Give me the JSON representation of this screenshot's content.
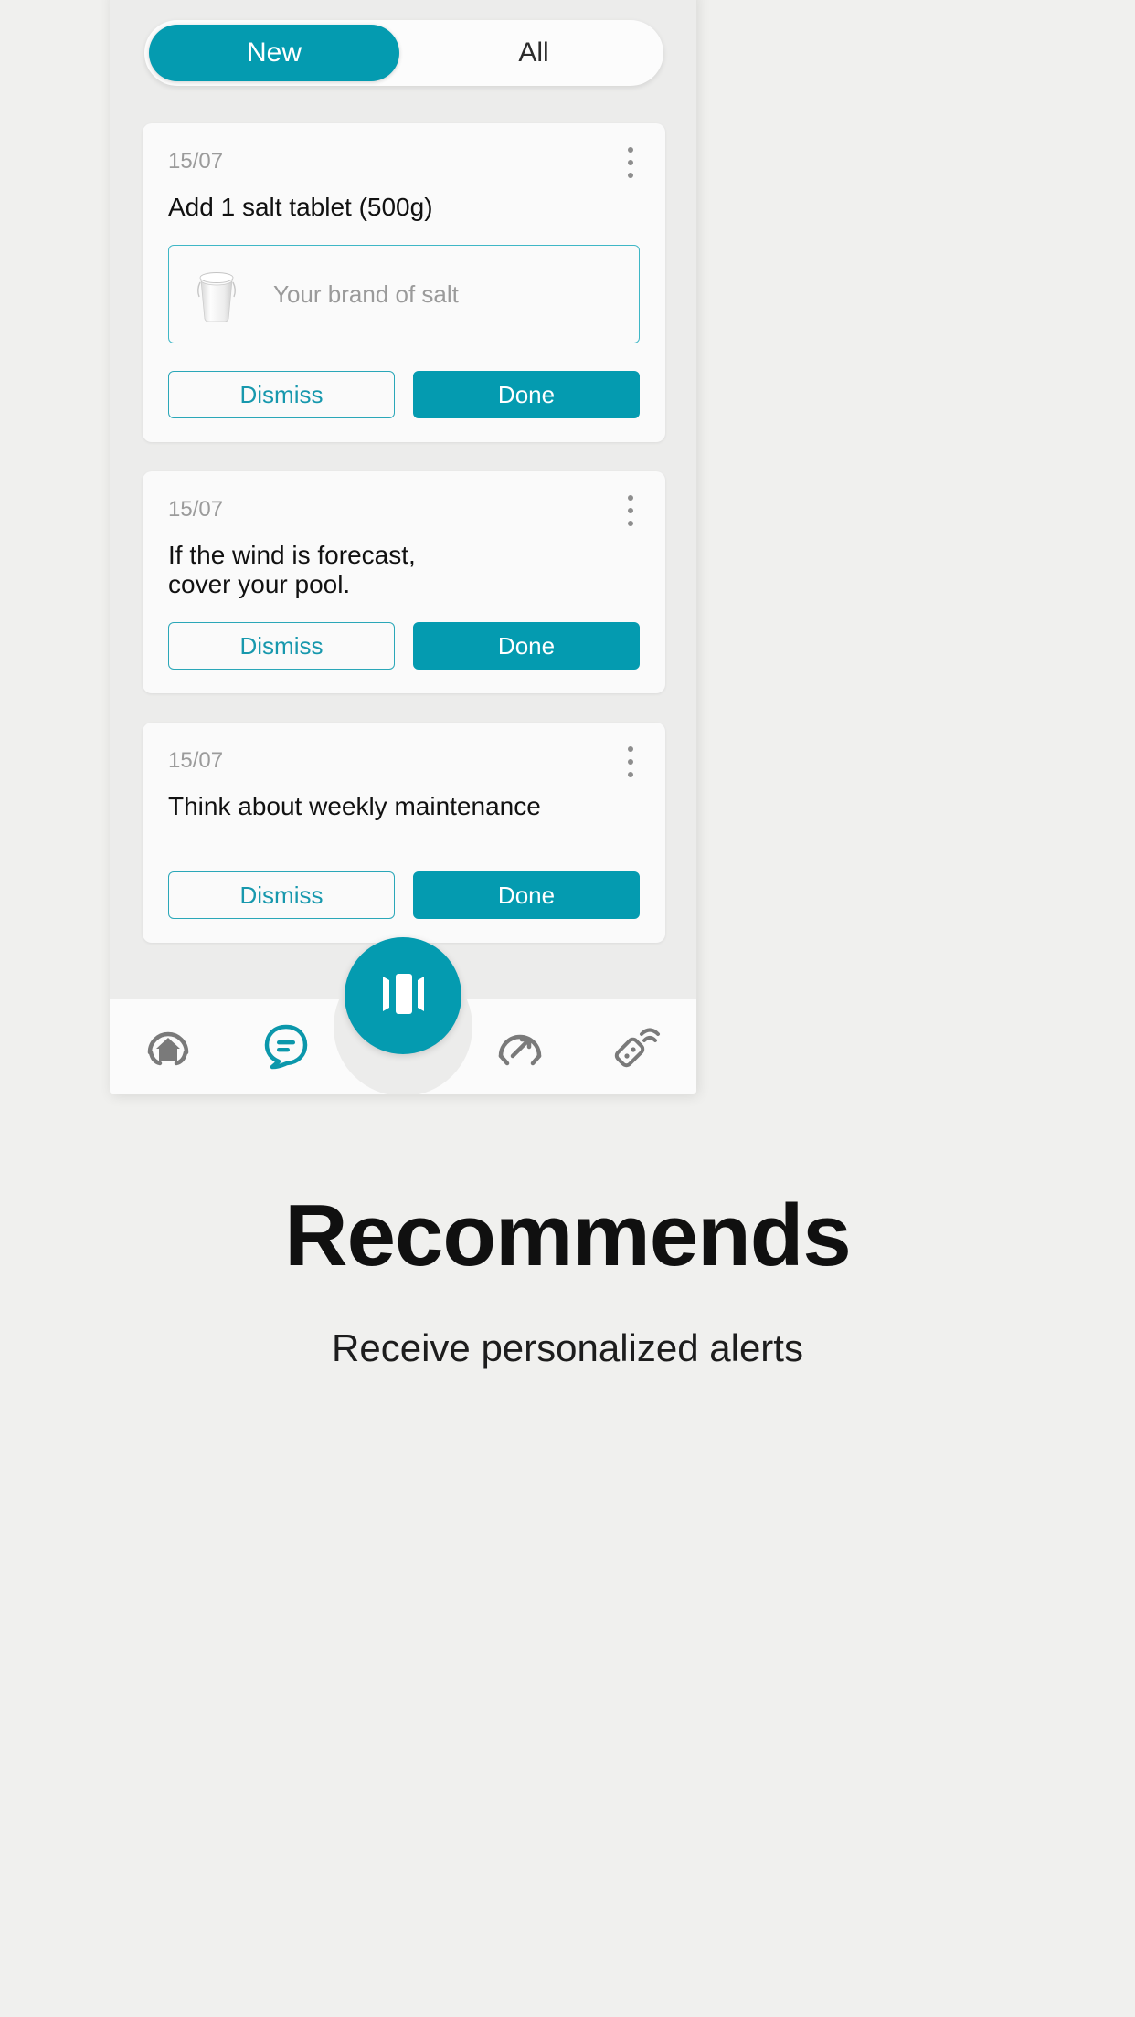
{
  "theme": {
    "accent": "#049bb0",
    "accent_light": "#3fb7c6",
    "page_bg": "#f0f0ee",
    "phone_bg": "#ececeb",
    "card_bg": "#fafafa",
    "muted_text": "#9b9b9b",
    "nav_inactive": "#7a7a7a"
  },
  "tabs": [
    {
      "label": "New",
      "active": true,
      "icon": "new-tab"
    },
    {
      "label": "All",
      "active": false,
      "icon": "all-tab"
    }
  ],
  "cards": [
    {
      "date": "15/07",
      "title": "Add 1 salt tablet (500g)",
      "menu_icon": "kebab-menu-icon",
      "brand_input": {
        "icon": "salt-bucket-icon",
        "placeholder": "Your brand of salt",
        "value": ""
      },
      "dismiss_label": "Dismiss",
      "done_label": "Done"
    },
    {
      "date": "15/07",
      "title": "If the wind is forecast,\ncover your pool.",
      "menu_icon": "kebab-menu-icon",
      "brand_input": null,
      "dismiss_label": "Dismiss",
      "done_label": "Done"
    },
    {
      "date": "15/07",
      "title": "Think about weekly maintenance",
      "menu_icon": "kebab-menu-icon",
      "brand_input": null,
      "dismiss_label": "Dismiss",
      "done_label": "Done"
    }
  ],
  "bottom_nav": {
    "items": [
      {
        "icon": "home-icon",
        "active": false
      },
      {
        "icon": "chat-bubble-icon",
        "active": true
      },
      {
        "icon": "gauge-icon",
        "active": false
      },
      {
        "icon": "remote-signal-icon",
        "active": false
      }
    ],
    "fab": {
      "icon": "carousel-cards-icon"
    }
  },
  "caption": {
    "headline": "Recommends",
    "subhead": "Receive personalized alerts"
  }
}
